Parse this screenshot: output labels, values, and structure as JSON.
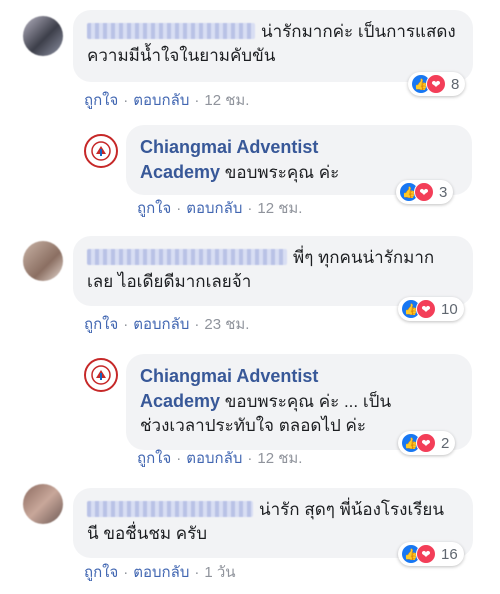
{
  "labels": {
    "like": "ถูกใจ",
    "reply": "ตอบกลับ",
    "separator": "·"
  },
  "page": {
    "name_line1": "Chiangmai Adventist",
    "name_line2": "Academy"
  },
  "comments": [
    {
      "text_line1": "น่ารักมากค่ะ เป็นการแสดง",
      "text_line2": "ความมีน้ำใจในยามคับขัน",
      "reaction_count": "8",
      "time": "12 ชม.",
      "reply": {
        "text_line1": "ขอบพระคุณ ค่ะ",
        "reaction_count": "3",
        "time": "12 ชม."
      }
    },
    {
      "text_line1": "พี่ๆ ทุกคนน่ารักมาก",
      "text_line2": "เลย ไอเดียดีมากเลยจ้า",
      "reaction_count": "10",
      "time": "23 ชม.",
      "reply": {
        "text_line1": "ขอบพระคุณ ค่ะ ... เป็น",
        "text_line2": "ช่วงเวลาประทับใจ ตลอดไป ค่ะ",
        "reaction_count": "2",
        "time": "12 ชม."
      }
    },
    {
      "text_line1": "น่ารัก สุดๆ พี่น้องโรงเรียน",
      "text_line2": "นี ขอชื่นชม ครับ",
      "reaction_count": "16",
      "time": "1 วัน"
    }
  ],
  "icons": {
    "like": "thumbs-up-icon",
    "love": "heart-icon",
    "more": "more-options-icon",
    "page_logo": "school-logo-icon"
  },
  "colors": {
    "like_blue": "#1877f2",
    "love_red": "#f33e58",
    "link_blue": "#4267b2",
    "page_name": "#385898",
    "bubble_bg": "#f2f3f5"
  }
}
